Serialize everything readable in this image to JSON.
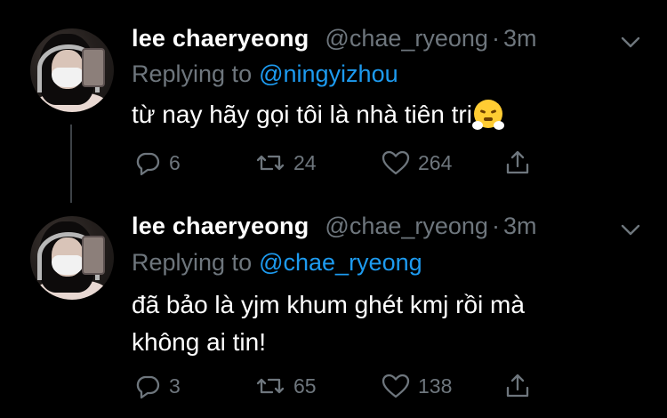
{
  "tweets": [
    {
      "display_name": "lee chaeryeong",
      "handle": "@chae_ryeong",
      "separator": "·",
      "time": "3m",
      "replying_prefix": "Replying to",
      "replying_to": "@ningyizhou",
      "text": "từ nay hãy gọi tôi là nhà tiên tri",
      "emoji": "face-with-steam-from-nose",
      "replies": "6",
      "retweets": "24",
      "likes": "264"
    },
    {
      "display_name": "lee chaeryeong",
      "handle": "@chae_ryeong",
      "separator": "·",
      "time": "3m",
      "replying_prefix": "Replying to",
      "replying_to": "@chae_ryeong",
      "text_line1": "đã bảo là yjm khum ghét kmj rồi mà",
      "text_line2": "không ai tin!",
      "replies": "3",
      "retweets": "65",
      "likes": "138"
    }
  ],
  "colors": {
    "background": "#000000",
    "primary_text": "#ffffff",
    "secondary_text": "#6e767d",
    "accent": "#1d9bf0",
    "thread_line": "#3d4247"
  },
  "icons": [
    "reply-icon",
    "retweet-icon",
    "like-icon",
    "share-icon",
    "caret-down-icon"
  ]
}
